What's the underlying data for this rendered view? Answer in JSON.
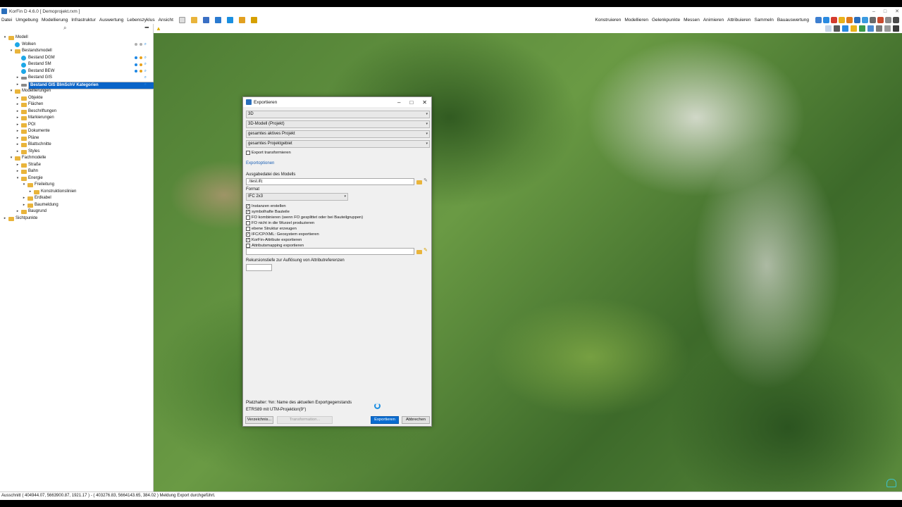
{
  "app": {
    "title": "KorFin D 4.6.0 [ Demoprojekt.rxm ]",
    "window_controls": [
      "–",
      "□",
      "✕"
    ]
  },
  "menu": {
    "left": [
      "Datei",
      "Umgebung",
      "Modellierung",
      "Infrastruktur",
      "Auswertung",
      "Lebenszyklus",
      "Ansicht"
    ],
    "right": [
      "Konstruieren",
      "Modellieren",
      "Gelenkpunkte",
      "Messen",
      "Animieren",
      "Attribuieren",
      "Sammeln",
      "Bauauswertung"
    ]
  },
  "tree": [
    {
      "label": "Modell",
      "toggle": "▾",
      "icon": "folder-icon",
      "level": 0
    },
    {
      "label": "Wolken",
      "toggle": "",
      "icon": "cloud-icon",
      "level": 1,
      "status": [
        "gray",
        "gray"
      ]
    },
    {
      "label": "Bestandsmodell",
      "toggle": "▾",
      "icon": "folder-icon",
      "level": 1
    },
    {
      "label": "Bestand DGM",
      "toggle": "",
      "icon": "terrain-icon",
      "level": 2,
      "status": [
        "blue",
        "orange"
      ]
    },
    {
      "label": "Bestand SM",
      "toggle": "",
      "icon": "terrain-icon",
      "level": 2,
      "status": [
        "blue",
        "orange"
      ]
    },
    {
      "label": "Bestand BEW",
      "toggle": "",
      "icon": "terrain-icon",
      "level": 2,
      "status": [
        "blue",
        "orange"
      ]
    },
    {
      "label": "Bestand GIS",
      "toggle": "▸",
      "icon": "layer-icon",
      "level": 2,
      "status": []
    },
    {
      "label": "Bestand GIS BImSchV Kategorien",
      "toggle": "▸",
      "icon": "layer-icon",
      "level": 2,
      "selected": true,
      "status": []
    },
    {
      "label": "Modellierungen",
      "toggle": "▾",
      "icon": "folder-icon",
      "level": 1
    },
    {
      "label": "Objekte",
      "toggle": "▸",
      "icon": "folder-icon",
      "level": 2
    },
    {
      "label": "Flächen",
      "toggle": "▸",
      "icon": "folder-icon",
      "level": 2
    },
    {
      "label": "Beschriftungen",
      "toggle": "▸",
      "icon": "folder-icon",
      "level": 2
    },
    {
      "label": "Markierungen",
      "toggle": "▸",
      "icon": "folder-icon",
      "level": 2
    },
    {
      "label": "POI",
      "toggle": "▸",
      "icon": "folder-icon",
      "level": 2
    },
    {
      "label": "Dokumente",
      "toggle": "▸",
      "icon": "folder-icon",
      "level": 2
    },
    {
      "label": "Pläne",
      "toggle": "▸",
      "icon": "folder-icon",
      "level": 2
    },
    {
      "label": "Blattschnitte",
      "toggle": "▸",
      "icon": "folder-icon",
      "level": 2
    },
    {
      "label": "Styles",
      "toggle": "▸",
      "icon": "folder-icon",
      "level": 2
    },
    {
      "label": "Fachmodelle",
      "toggle": "▾",
      "icon": "folder-icon",
      "level": 1
    },
    {
      "label": "Straße",
      "toggle": "▸",
      "icon": "folder-icon",
      "level": 2
    },
    {
      "label": "Bahn",
      "toggle": "▸",
      "icon": "folder-icon",
      "level": 2
    },
    {
      "label": "Energie",
      "toggle": "▾",
      "icon": "folder-icon",
      "level": 2
    },
    {
      "label": "Freileitung",
      "toggle": "▾",
      "icon": "folder-icon",
      "level": 3
    },
    {
      "label": "Konstruktionslinien",
      "toggle": "▸",
      "icon": "folder-icon",
      "level": 4
    },
    {
      "label": "Erdkabel",
      "toggle": "▸",
      "icon": "folder-icon",
      "level": 3
    },
    {
      "label": "Baumeldung",
      "toggle": "▸",
      "icon": "folder-icon",
      "level": 3
    },
    {
      "label": "Baugrund",
      "toggle": "▸",
      "icon": "folder-icon",
      "level": 2
    },
    {
      "label": "Sichtpunkte",
      "toggle": "▸",
      "icon": "folder-icon",
      "level": 0
    }
  ],
  "dialog": {
    "title": "Exportieren",
    "selects": [
      "3D",
      "3D-Modell (Projekt)",
      "gesamtes aktives Projekt",
      "gesamtes Projektgebiet"
    ],
    "transform_label": "Export transformieren",
    "options_link": "Exportoptionen",
    "output_label": "Ausgabedatei des Modells",
    "output_value": ".\\test.ifc",
    "format_label": "Format",
    "format_value": "IFC 2x3",
    "checks": [
      {
        "label": "Instanzen erstellen",
        "checked": true
      },
      {
        "label": "symbolhafte Bauteile",
        "checked": true
      },
      {
        "label": "FO kombinieren (wenn FO gesplittet oder bei Bauteilgruppen)",
        "checked": false
      },
      {
        "label": "FO nicht in die Wurzel produzieren",
        "checked": false
      },
      {
        "label": "ebene Struktur erzeugen",
        "checked": false
      },
      {
        "label": "IFC/CP/XML: Geosystem exportieren",
        "checked": true
      },
      {
        "label": "KorFin-Attribute exportieren",
        "checked": true
      },
      {
        "label": "Attributsmapping exportieren",
        "checked": false
      }
    ],
    "recursion_label": "Rekursionstiefe zur Auflösung von Attributreferenzen",
    "recursion_value": "",
    "placeholder_text": "Platzhalter: %n: Name des aktuellen Exportgegenstands",
    "crs_text": "ETRS89 mit UTM-Projektion(9°)",
    "btn_dir": "Verzeichnis...",
    "btn_transform": "Transformation...",
    "btn_export": "Exportieren",
    "btn_cancel": "Abbrechen"
  },
  "status": {
    "text": "Ausschnitt  ( 404944.07, 5663900.87, 1921.17 ) - ( 403276.83, 5664143.65, 384.02 )  Meldung   Export durchgeführt."
  }
}
